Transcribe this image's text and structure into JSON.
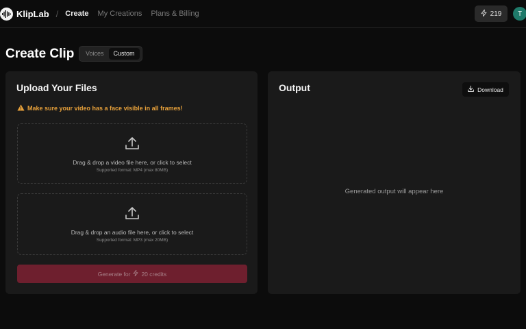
{
  "app": {
    "name": "KlipLab"
  },
  "nav": {
    "separator": "/",
    "items": [
      {
        "label": "Create",
        "active": true
      },
      {
        "label": "My Creations",
        "active": false
      },
      {
        "label": "Plans & Billing",
        "active": false
      }
    ]
  },
  "header": {
    "credits": "219",
    "avatar_initial": "T",
    "avatar_color": "#1f7a6a"
  },
  "page": {
    "title": "Create Clip",
    "mode_tabs": [
      {
        "label": "Voices",
        "active": false
      },
      {
        "label": "Custom",
        "active": true
      }
    ]
  },
  "upload": {
    "title": "Upload Your Files",
    "warning": "Make sure your video has a face visible in all frames!",
    "video_drop": {
      "text": "Drag & drop a video file here, or click to select",
      "sub": "Supported format: MP4 (max 80MB)"
    },
    "audio_drop": {
      "text": "Drag & drop an audio file here, or click to select",
      "sub": "Supported format: MP3 (max 20MB)"
    },
    "generate_prefix": "Generate for",
    "generate_suffix": "20 credits"
  },
  "output": {
    "title": "Output",
    "download_label": "Download",
    "empty_text": "Generated output will appear here"
  },
  "colors": {
    "background": "#0c0c0c",
    "card": "#1a1a1a",
    "warning": "#e9a23b",
    "generate_button": "#6e1f2e"
  },
  "icons": [
    "soundwave-logo-icon",
    "lightning-icon",
    "warning-triangle-icon",
    "upload-icon",
    "download-icon"
  ]
}
